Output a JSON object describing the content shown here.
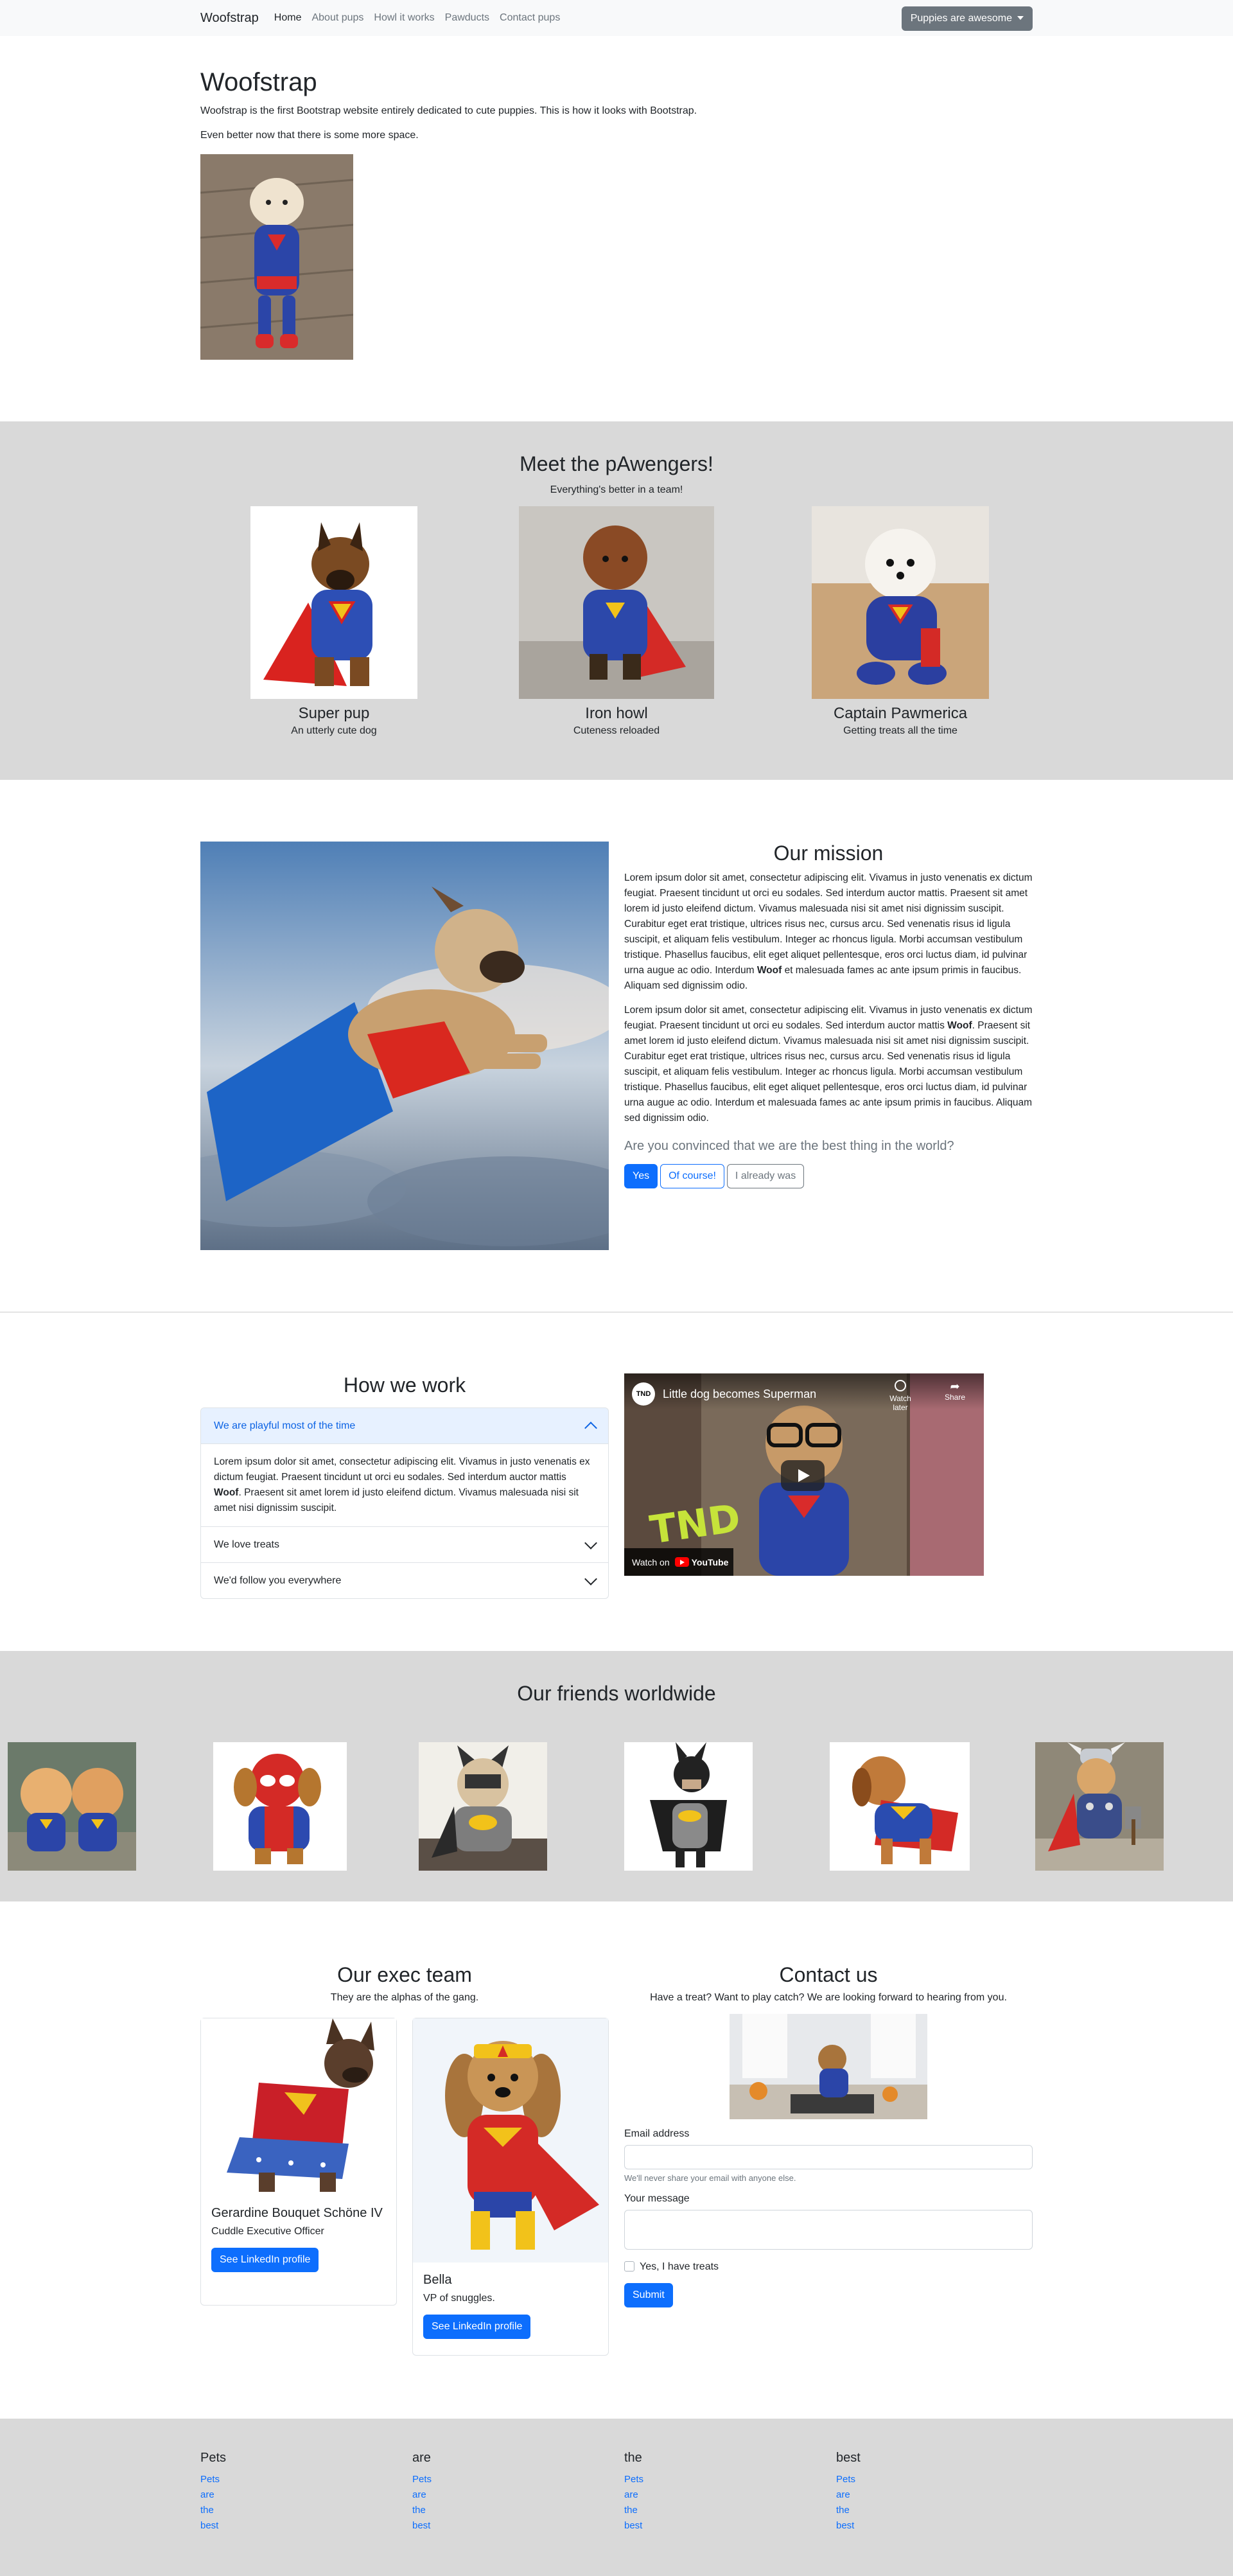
{
  "navbar": {
    "brand": "Woofstrap",
    "links": [
      "Home",
      "About pups",
      "Howl it works",
      "Pawducts",
      "Contact pups"
    ],
    "dropdown": "Puppies are awesome"
  },
  "hero": {
    "title": "Woofstrap",
    "line1": "Woofstrap is the first Bootstrap website entirely dedicated to cute puppies. This is how it looks with Bootstrap.",
    "line2": "Even better now that there is some more space."
  },
  "team": {
    "title": "Meet the pAwengers!",
    "subtitle": "Everything's better in a team!",
    "members": [
      {
        "name": "Super pup",
        "desc": "An utterly cute dog"
      },
      {
        "name": "Iron howl",
        "desc": "Cuteness reloaded"
      },
      {
        "name": "Captain Pawmerica",
        "desc": "Getting treats all the time"
      }
    ]
  },
  "mission": {
    "title": "Our mission",
    "p1_a": "Lorem ipsum dolor sit amet, consectetur adipiscing elit. Vivamus in justo venenatis ex dictum feugiat. Praesent tincidunt ut orci eu sodales. Sed interdum auctor mattis. Praesent sit amet lorem id justo eleifend dictum. Vivamus malesuada nisi sit amet nisi dignissim suscipit. Curabitur eget erat tristique, ultrices risus nec, cursus arcu. Sed venenatis risus id ligula suscipit, et aliquam felis vestibulum. Integer ac rhoncus ligula. Morbi accumsan vestibulum tristique. Phasellus faucibus, elit eget aliquet pellentesque, eros orci luctus diam, id pulvinar urna augue ac odio. Interdum",
    "p1_b": "et malesuada fames ac ante ipsum primis in faucibus. Aliquam sed dignissim odio.",
    "p2_a": "Lorem ipsum dolor sit amet, consectetur adipiscing elit. Vivamus in justo venenatis ex dictum feugiat. Praesent tincidunt ut orci eu sodales. Sed interdum auctor mattis",
    "p2_b": "Praesent sit amet lorem id justo eleifend dictum. Vivamus malesuada nisi sit amet nisi dignissim suscipit. Curabitur eget erat tristique, ultrices risus nec, cursus arcu. Sed venenatis risus id ligula suscipit, et aliquam felis vestibulum. Integer ac rhoncus ligula. Morbi accumsan vestibulum tristique. Phasellus faucibus, elit eget aliquet pellentesque, eros orci luctus diam, id pulvinar urna augue ac odio. Interdum et malesuada fames ac ante ipsum primis in faucibus. Aliquam sed dignissim odio.",
    "bold": "Woof",
    "question": "Are you convinced that we are the best thing in the world?",
    "buttons": [
      "Yes",
      "Of course!",
      "I already was"
    ]
  },
  "how": {
    "title": "How we work",
    "items": [
      {
        "label": "We are playful most of the time"
      },
      {
        "label": "We love treats"
      },
      {
        "label": "We'd follow you everywhere"
      }
    ],
    "body_a": "Lorem ipsum dolor sit amet, consectetur adipiscing elit. Vivamus in justo venenatis ex dictum feugiat. Praesent tincidunt ut orci eu sodales. Sed interdum auctor mattis",
    "body_b": ". Praesent sit amet lorem id justo eleifend dictum. Vivamus malesuada nisi sit amet nisi dignissim suscipit.",
    "bold": "Woof",
    "video": {
      "title": "Little dog becomes Superman",
      "watch_later": "Watch later",
      "share": "Share",
      "watch_on": "Watch on",
      "youtube": "YouTube",
      "channel": "TND",
      "overlay": "TND"
    }
  },
  "friends": {
    "title": "Our friends worldwide"
  },
  "exec": {
    "title": "Our exec team",
    "subtitle": "They are the alphas of the gang.",
    "people": [
      {
        "name": "Gerardine Bouquet Schöne IV",
        "role": "Cuddle Executive Officer",
        "button": "See LinkedIn profile"
      },
      {
        "name": "Bella",
        "role": "VP of snuggles.",
        "button": "See LinkedIn profile"
      }
    ]
  },
  "contact": {
    "title": "Contact us",
    "subtitle": "Have a treat? Want to play catch? We are looking forward to hearing from you.",
    "email_label": "Email address",
    "email_help": "We'll never share your email with anyone else.",
    "message_label": "Your message",
    "check_label": "Yes, I have treats",
    "submit": "Submit"
  },
  "footer": {
    "columns": [
      {
        "title": "Pets",
        "links": [
          "Pets",
          "are",
          "the",
          "best"
        ]
      },
      {
        "title": "are",
        "links": [
          "Pets",
          "are",
          "the",
          "best"
        ]
      },
      {
        "title": "the",
        "links": [
          "Pets",
          "are",
          "the",
          "best"
        ]
      },
      {
        "title": "best",
        "links": [
          "Pets",
          "are",
          "the",
          "best"
        ]
      }
    ]
  },
  "colors": {
    "primary": "#0d6efd",
    "band": "#d9d9d9",
    "navbar": "#f8f9fa"
  }
}
